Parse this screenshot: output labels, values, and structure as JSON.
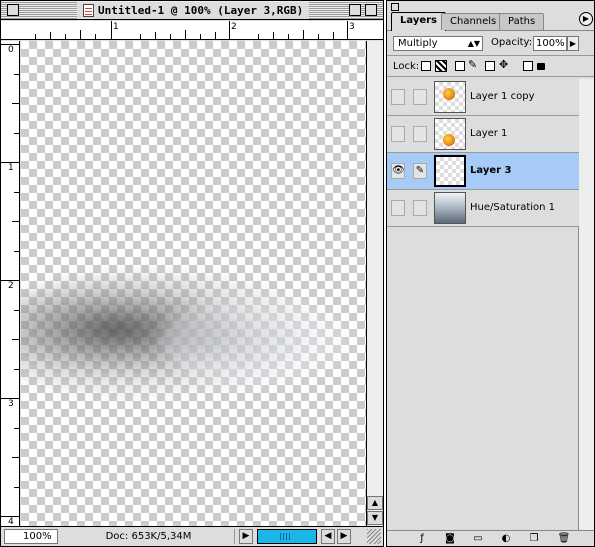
{
  "document": {
    "title": "Untitled-1 @ 100% (Layer 3,RGB)",
    "ruler_top": [
      "1",
      "2",
      "3"
    ],
    "ruler_left": [
      "0",
      "1",
      "2",
      "3",
      "4"
    ],
    "zoom": "100%",
    "doc_info": "Doc: 653K/5,34M"
  },
  "layers_palette": {
    "tabs": [
      {
        "label": "Layers",
        "active": true
      },
      {
        "label": "Channels",
        "active": false
      },
      {
        "label": "Paths",
        "active": false
      }
    ],
    "blend_mode": "Multiply",
    "opacity_label": "Opacity:",
    "opacity_value": "100%",
    "lock_label": "Lock:",
    "layers": [
      {
        "name": "Layer 1 copy",
        "visible": false,
        "selected": false,
        "thumb": "star-top"
      },
      {
        "name": "Layer 1",
        "visible": false,
        "selected": false,
        "thumb": "star-bottom"
      },
      {
        "name": "Layer 3",
        "visible": true,
        "selected": true,
        "thumb": "transparent"
      },
      {
        "name": "Hue/Saturation 1",
        "visible": false,
        "selected": false,
        "thumb": "adjustment-gradient"
      }
    ],
    "bottom_icons": [
      "layer-style-icon",
      "mask-icon",
      "folder-icon",
      "adjustment-icon",
      "new-layer-icon",
      "trash-icon"
    ]
  },
  "colors": {
    "selection": "#a6cbf7",
    "progress": "#1ab6e8",
    "chrome": "#dddddd"
  }
}
